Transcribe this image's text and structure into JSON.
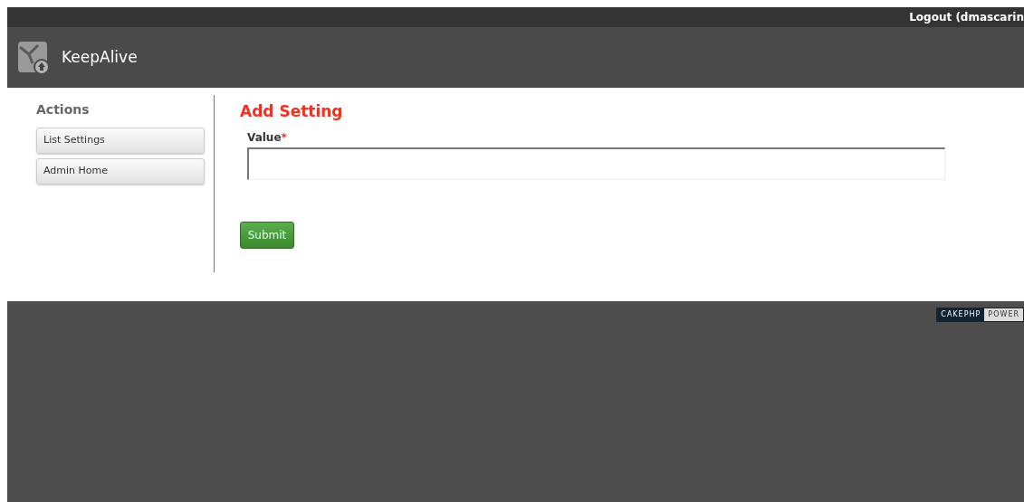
{
  "top_bar": {
    "logout": "Logout (dmascarin"
  },
  "header": {
    "title": "KeepAlive"
  },
  "sidebar": {
    "heading": "Actions",
    "items": [
      "List Settings",
      "Admin Home"
    ]
  },
  "form": {
    "title": "Add Setting",
    "fields": [
      {
        "label": "Value",
        "required_mark": "*"
      }
    ],
    "submit": "Submit"
  },
  "footer": {
    "badge": [
      "CAKEPHP",
      "POWER"
    ]
  }
}
